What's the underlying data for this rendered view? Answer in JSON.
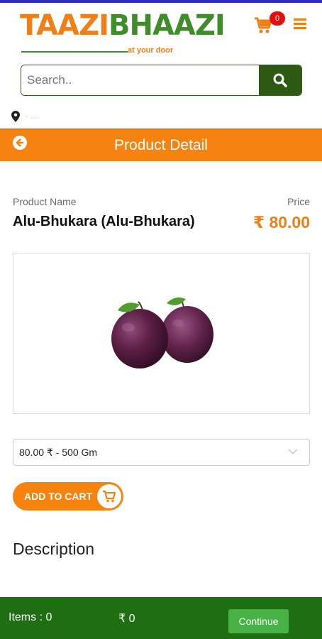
{
  "brand": {
    "name_part1": "TAAZI",
    "name_part2": "BHAAZI",
    "tagline": "at your door"
  },
  "header": {
    "cart_count": "0"
  },
  "search": {
    "placeholder": "Search.."
  },
  "location": {
    "text": "· ..."
  },
  "page": {
    "title": "Product Detail"
  },
  "product": {
    "name_label": "Product Name",
    "name": "Alu-Bhukara (Alu-Bhukara)",
    "price_label": "Price",
    "price": "₹ 80.00",
    "selected_variant": "80.00 ₹ - 500 Gm",
    "add_to_cart_label": "ADD TO CART",
    "description_title": "Description"
  },
  "footer": {
    "items": "Items : 0",
    "total": "₹ 0",
    "continue_label": "Continue"
  },
  "colors": {
    "accent_orange": "#f6820f",
    "brand_green": "#3e8d2a",
    "footer_green": "#1e6f12",
    "button_green": "#48b246",
    "badge_red": "#e01010"
  }
}
